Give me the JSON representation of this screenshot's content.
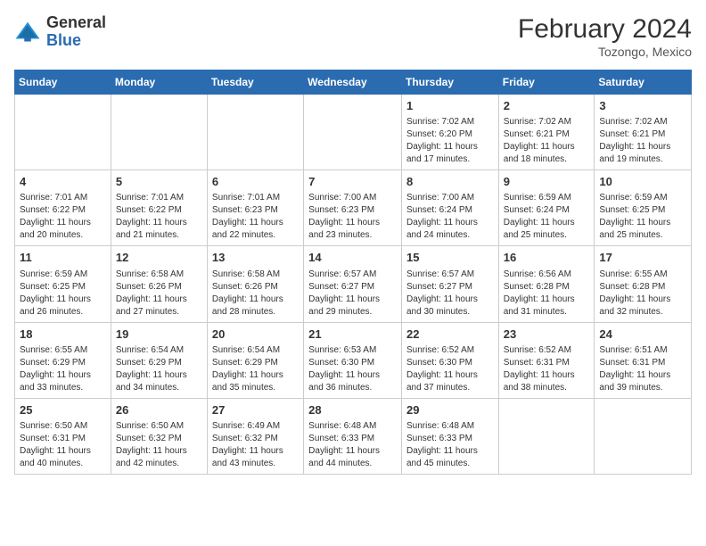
{
  "header": {
    "logo_line1": "General",
    "logo_line2": "Blue",
    "title": "February 2024",
    "subtitle": "Tozongo, Mexico"
  },
  "weekdays": [
    "Sunday",
    "Monday",
    "Tuesday",
    "Wednesday",
    "Thursday",
    "Friday",
    "Saturday"
  ],
  "weeks": [
    [
      {
        "day": "",
        "sunrise": "",
        "sunset": "",
        "daylight": ""
      },
      {
        "day": "",
        "sunrise": "",
        "sunset": "",
        "daylight": ""
      },
      {
        "day": "",
        "sunrise": "",
        "sunset": "",
        "daylight": ""
      },
      {
        "day": "",
        "sunrise": "",
        "sunset": "",
        "daylight": ""
      },
      {
        "day": "1",
        "sunrise": "7:02 AM",
        "sunset": "6:20 PM",
        "daylight": "11 hours and 17 minutes."
      },
      {
        "day": "2",
        "sunrise": "7:02 AM",
        "sunset": "6:21 PM",
        "daylight": "11 hours and 18 minutes."
      },
      {
        "day": "3",
        "sunrise": "7:02 AM",
        "sunset": "6:21 PM",
        "daylight": "11 hours and 19 minutes."
      }
    ],
    [
      {
        "day": "4",
        "sunrise": "7:01 AM",
        "sunset": "6:22 PM",
        "daylight": "11 hours and 20 minutes."
      },
      {
        "day": "5",
        "sunrise": "7:01 AM",
        "sunset": "6:22 PM",
        "daylight": "11 hours and 21 minutes."
      },
      {
        "day": "6",
        "sunrise": "7:01 AM",
        "sunset": "6:23 PM",
        "daylight": "11 hours and 22 minutes."
      },
      {
        "day": "7",
        "sunrise": "7:00 AM",
        "sunset": "6:23 PM",
        "daylight": "11 hours and 23 minutes."
      },
      {
        "day": "8",
        "sunrise": "7:00 AM",
        "sunset": "6:24 PM",
        "daylight": "11 hours and 24 minutes."
      },
      {
        "day": "9",
        "sunrise": "6:59 AM",
        "sunset": "6:24 PM",
        "daylight": "11 hours and 25 minutes."
      },
      {
        "day": "10",
        "sunrise": "6:59 AM",
        "sunset": "6:25 PM",
        "daylight": "11 hours and 25 minutes."
      }
    ],
    [
      {
        "day": "11",
        "sunrise": "6:59 AM",
        "sunset": "6:25 PM",
        "daylight": "11 hours and 26 minutes."
      },
      {
        "day": "12",
        "sunrise": "6:58 AM",
        "sunset": "6:26 PM",
        "daylight": "11 hours and 27 minutes."
      },
      {
        "day": "13",
        "sunrise": "6:58 AM",
        "sunset": "6:26 PM",
        "daylight": "11 hours and 28 minutes."
      },
      {
        "day": "14",
        "sunrise": "6:57 AM",
        "sunset": "6:27 PM",
        "daylight": "11 hours and 29 minutes."
      },
      {
        "day": "15",
        "sunrise": "6:57 AM",
        "sunset": "6:27 PM",
        "daylight": "11 hours and 30 minutes."
      },
      {
        "day": "16",
        "sunrise": "6:56 AM",
        "sunset": "6:28 PM",
        "daylight": "11 hours and 31 minutes."
      },
      {
        "day": "17",
        "sunrise": "6:55 AM",
        "sunset": "6:28 PM",
        "daylight": "11 hours and 32 minutes."
      }
    ],
    [
      {
        "day": "18",
        "sunrise": "6:55 AM",
        "sunset": "6:29 PM",
        "daylight": "11 hours and 33 minutes."
      },
      {
        "day": "19",
        "sunrise": "6:54 AM",
        "sunset": "6:29 PM",
        "daylight": "11 hours and 34 minutes."
      },
      {
        "day": "20",
        "sunrise": "6:54 AM",
        "sunset": "6:29 PM",
        "daylight": "11 hours and 35 minutes."
      },
      {
        "day": "21",
        "sunrise": "6:53 AM",
        "sunset": "6:30 PM",
        "daylight": "11 hours and 36 minutes."
      },
      {
        "day": "22",
        "sunrise": "6:52 AM",
        "sunset": "6:30 PM",
        "daylight": "11 hours and 37 minutes."
      },
      {
        "day": "23",
        "sunrise": "6:52 AM",
        "sunset": "6:31 PM",
        "daylight": "11 hours and 38 minutes."
      },
      {
        "day": "24",
        "sunrise": "6:51 AM",
        "sunset": "6:31 PM",
        "daylight": "11 hours and 39 minutes."
      }
    ],
    [
      {
        "day": "25",
        "sunrise": "6:50 AM",
        "sunset": "6:31 PM",
        "daylight": "11 hours and 40 minutes."
      },
      {
        "day": "26",
        "sunrise": "6:50 AM",
        "sunset": "6:32 PM",
        "daylight": "11 hours and 42 minutes."
      },
      {
        "day": "27",
        "sunrise": "6:49 AM",
        "sunset": "6:32 PM",
        "daylight": "11 hours and 43 minutes."
      },
      {
        "day": "28",
        "sunrise": "6:48 AM",
        "sunset": "6:33 PM",
        "daylight": "11 hours and 44 minutes."
      },
      {
        "day": "29",
        "sunrise": "6:48 AM",
        "sunset": "6:33 PM",
        "daylight": "11 hours and 45 minutes."
      },
      {
        "day": "",
        "sunrise": "",
        "sunset": "",
        "daylight": ""
      },
      {
        "day": "",
        "sunrise": "",
        "sunset": "",
        "daylight": ""
      }
    ]
  ]
}
